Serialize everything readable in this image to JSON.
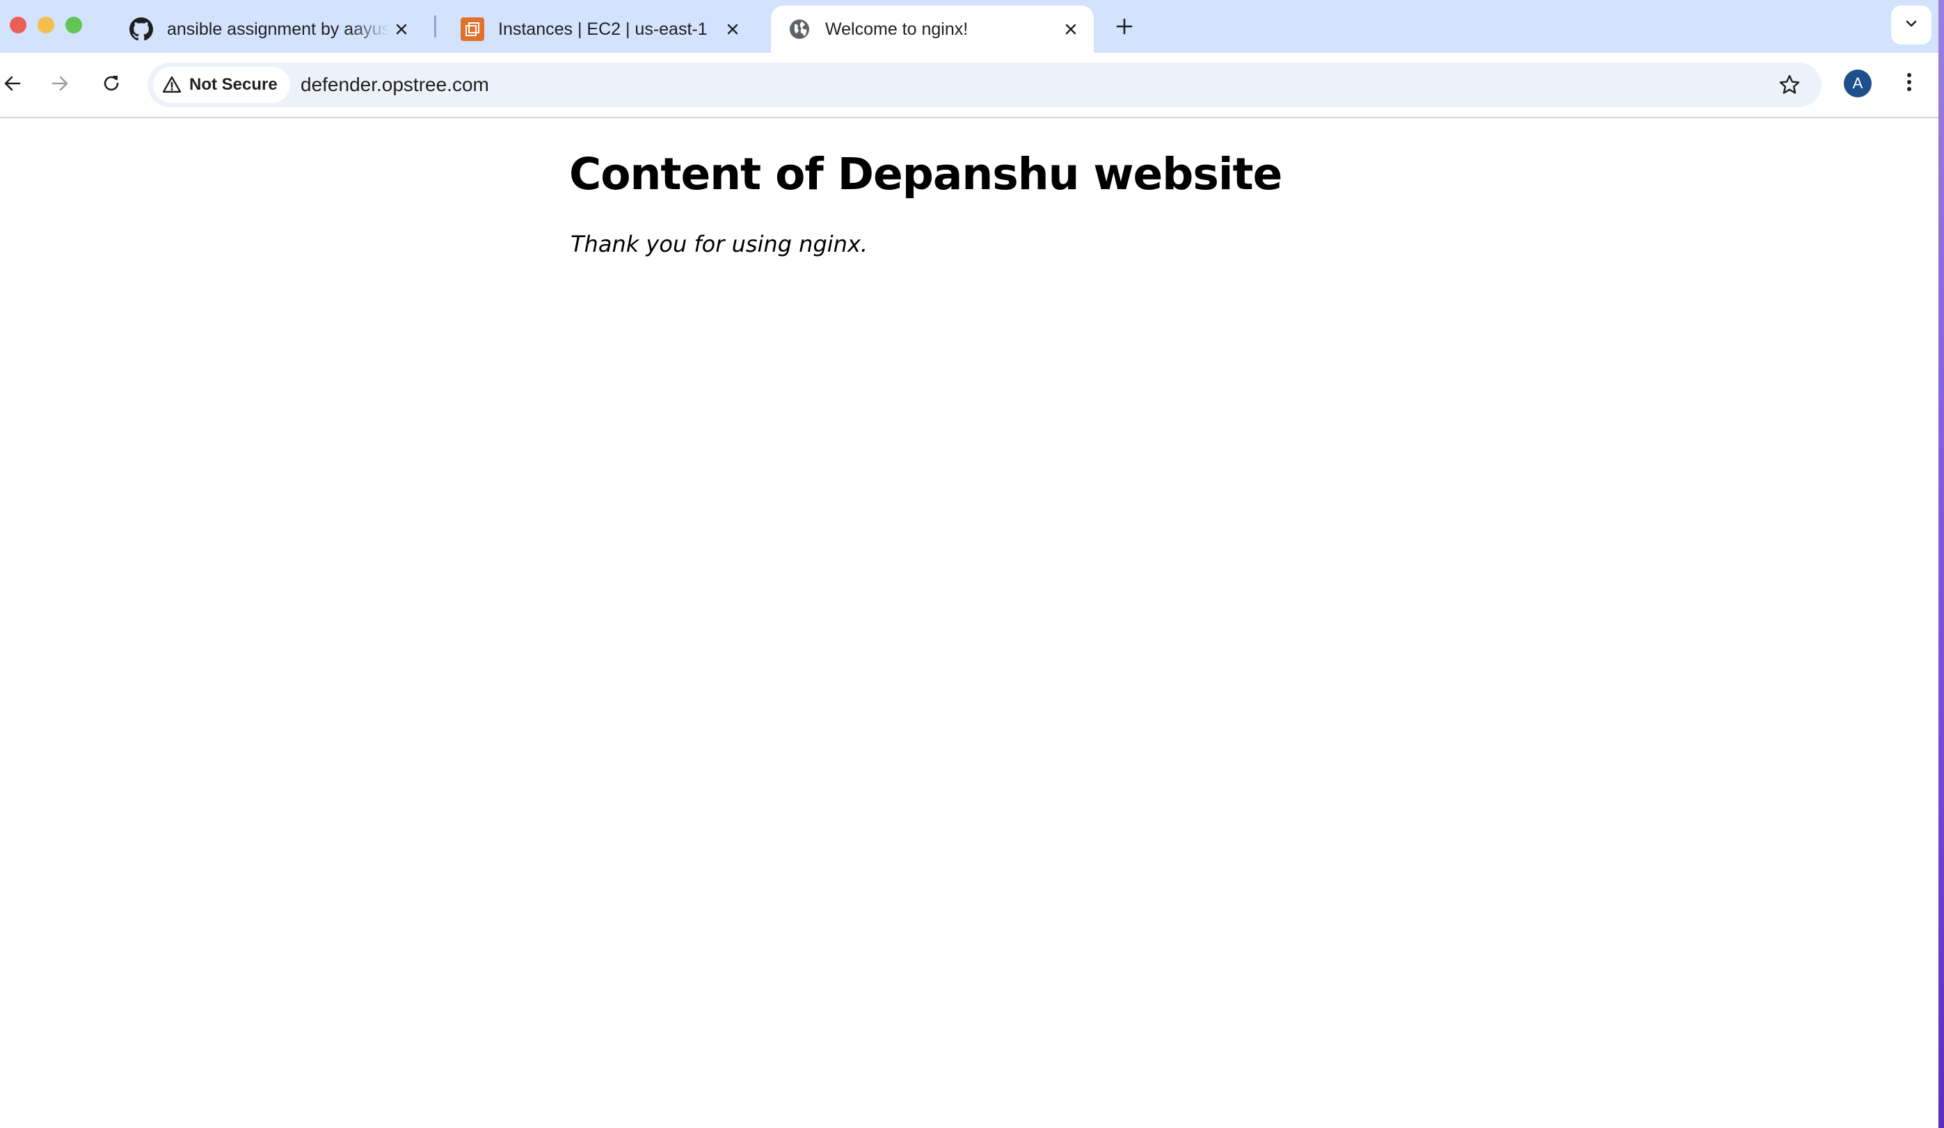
{
  "browser": {
    "tabs": [
      {
        "title": "ansible assignment by aayush",
        "favicon": "github-icon",
        "active": false
      },
      {
        "title": "Instances | EC2 | us-east-1",
        "favicon": "aws-ec2-icon",
        "active": false
      },
      {
        "title": "Welcome to nginx!",
        "favicon": "globe-icon",
        "active": true
      }
    ],
    "address_bar": {
      "security_label": "Not Secure",
      "security_icon": "warning-icon",
      "url": "defender.opstree.com"
    },
    "profile_initial": "A",
    "colors": {
      "tabstrip": "#d3e3fd",
      "omnibox": "#edf2fa",
      "avatar": "#1f4e8c"
    }
  },
  "page": {
    "heading": "Content of Depanshu website",
    "text": "Thank you for using nginx."
  }
}
